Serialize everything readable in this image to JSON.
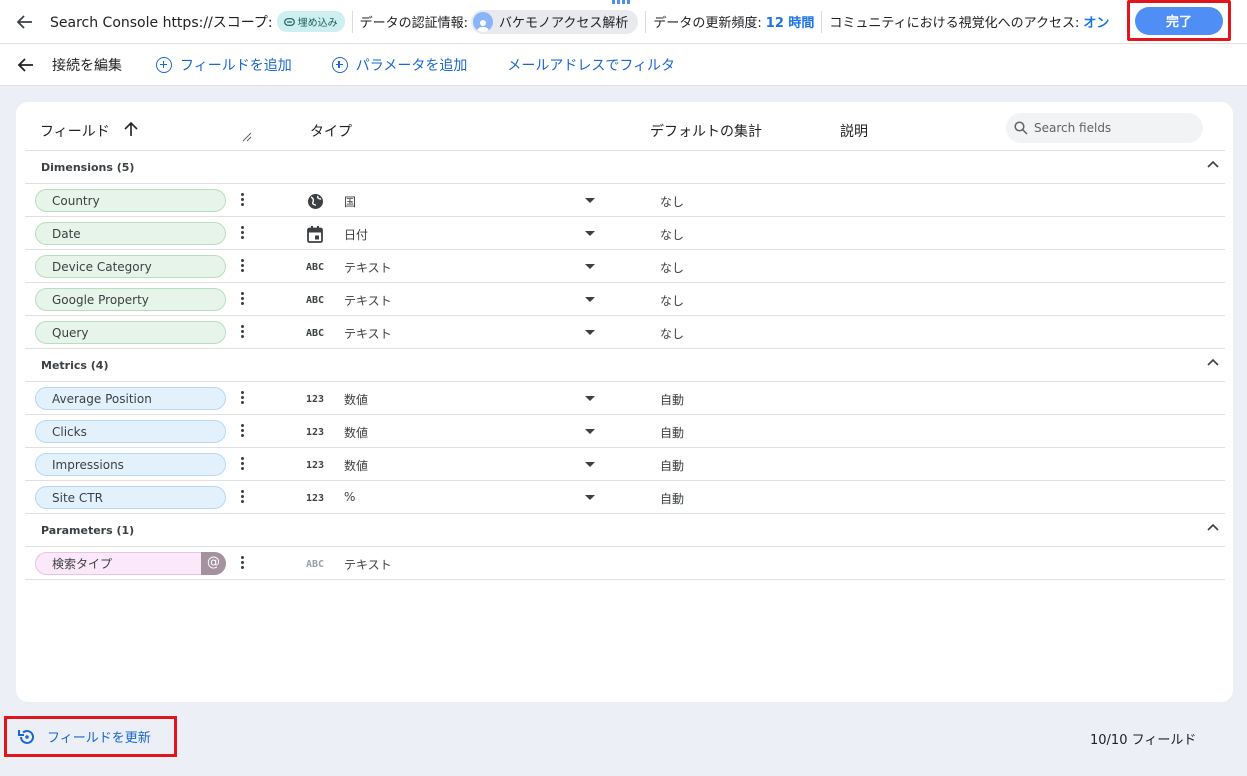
{
  "header": {
    "title_prefix": "Search Console https://スコープ:",
    "scope_pill": "埋め込み",
    "credentials_label": "データの認証情報:",
    "credentials_user": "バケモノアクセス解析",
    "freshness_label": "データの更新頻度:",
    "freshness_value": "12 時間",
    "community_label": "コミュニティにおける視覚化へのアクセス:",
    "community_value": "オン",
    "done_label": "完了"
  },
  "toolbar": {
    "edit_connection": "接続を編集",
    "add_field": "フィールドを追加",
    "add_parameter": "パラメータを追加",
    "filter_by_email": "メールアドレスでフィルタ"
  },
  "table": {
    "col_field": "フィールド",
    "col_type": "タイプ",
    "col_aggregation": "デフォルトの集計",
    "col_description": "説明",
    "search_placeholder": "Search fields"
  },
  "sections": {
    "dimensions": {
      "label": "Dimensions (5)",
      "rows": [
        {
          "name": "Country",
          "type_icon": "globe-icon",
          "type": "国",
          "agg": "なし"
        },
        {
          "name": "Date",
          "type_icon": "calendar-icon",
          "type": "日付",
          "agg": "なし"
        },
        {
          "name": "Device Category",
          "type_icon": "abc-icon",
          "type": "テキスト",
          "agg": "なし"
        },
        {
          "name": "Google Property",
          "type_icon": "abc-icon",
          "type": "テキスト",
          "agg": "なし"
        },
        {
          "name": "Query",
          "type_icon": "abc-icon",
          "type": "テキスト",
          "agg": "なし"
        }
      ]
    },
    "metrics": {
      "label": "Metrics (4)",
      "rows": [
        {
          "name": "Average Position",
          "type_icon": "123-icon",
          "type": "数値",
          "agg": "自動"
        },
        {
          "name": "Clicks",
          "type_icon": "123-icon",
          "type": "数値",
          "agg": "自動"
        },
        {
          "name": "Impressions",
          "type_icon": "123-icon",
          "type": "数値",
          "agg": "自動"
        },
        {
          "name": "Site CTR",
          "type_icon": "123-icon",
          "type": "%",
          "agg": "自動"
        }
      ]
    },
    "parameters": {
      "label": "Parameters (1)",
      "rows": [
        {
          "name": "検索タイプ",
          "badge": "@",
          "type_icon": "abc-icon",
          "type": "テキスト"
        }
      ]
    }
  },
  "icons": {
    "abc": "ABC",
    "num": "123"
  },
  "footer": {
    "refresh_label": "フィールドを更新",
    "field_count": "10/10 フィールド"
  },
  "colors": {
    "accent": "#1a73e8",
    "done_button": "#4e8ef5",
    "dimension_chip": "#e6f4ea",
    "metric_chip": "#e3f1fd",
    "parameter_chip": "#fbe8fb",
    "highlight_border": "#e0161a"
  }
}
